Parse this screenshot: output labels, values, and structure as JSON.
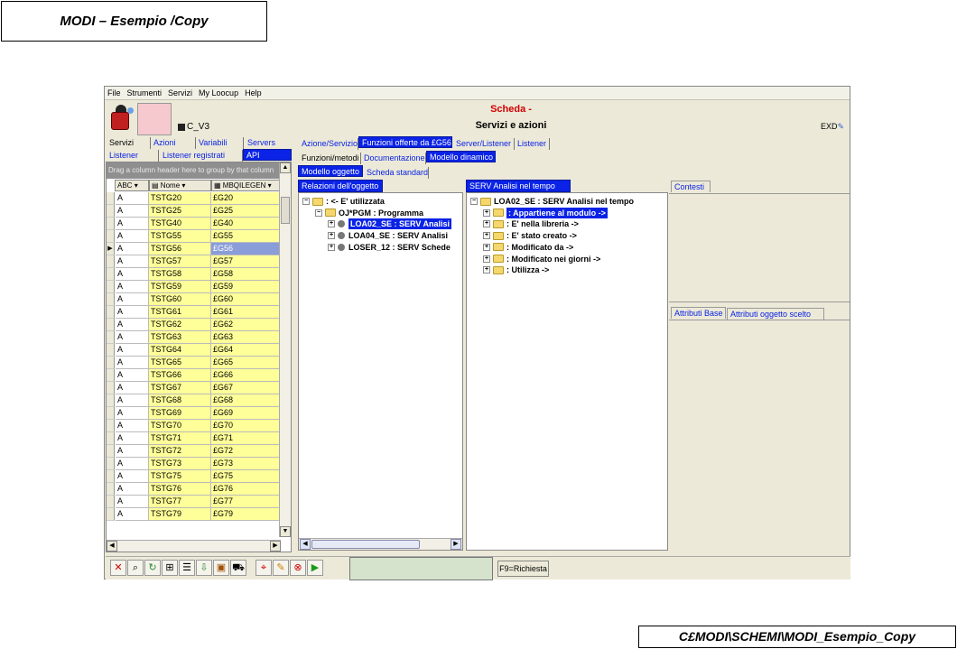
{
  "slide": {
    "title": "MODI – Esempio /Copy",
    "footer": "C£MODI\\SCHEMI\\MODI_Esempio_Copy"
  },
  "menu": [
    "File",
    "Strumenti",
    "Servizi",
    "My Loocup",
    "Help"
  ],
  "header": {
    "object_code": "C_V3",
    "title_red": "Scheda -",
    "title": "Servizi e azioni",
    "exd": "EXD"
  },
  "left_tabs_row1": [
    "Servizi",
    "Azioni",
    "Variabili",
    "Servers"
  ],
  "left_tabs_row2": [
    "Listener",
    "Listener registrati",
    "API"
  ],
  "right_tabs_row1": [
    "Azione/Servizio",
    "Funzioni offerte da £G56",
    "Server/Listener",
    "Listener"
  ],
  "right_tabs_row2": [
    "Funzioni/metodi",
    "Documentazione",
    "Modello dinamico"
  ],
  "right_tabs_row3": [
    "Modello oggetto",
    "Scheda standard"
  ],
  "grid": {
    "group_hint": "Drag a column header here to group by that column",
    "columns": [
      "ABC",
      "Nome",
      "MBQILEGEN"
    ],
    "rows": [
      [
        "A",
        "TSTG20",
        "£G20"
      ],
      [
        "A",
        "TSTG25",
        "£G25"
      ],
      [
        "A",
        "TSTG40",
        "£G40"
      ],
      [
        "A",
        "TSTG55",
        "£G55"
      ],
      [
        "A",
        "TSTG56",
        "£G56"
      ],
      [
        "A",
        "TSTG57",
        "£G57"
      ],
      [
        "A",
        "TSTG58",
        "£G58"
      ],
      [
        "A",
        "TSTG59",
        "£G59"
      ],
      [
        "A",
        "TSTG60",
        "£G60"
      ],
      [
        "A",
        "TSTG61",
        "£G61"
      ],
      [
        "A",
        "TSTG62",
        "£G62"
      ],
      [
        "A",
        "TSTG63",
        "£G63"
      ],
      [
        "A",
        "TSTG64",
        "£G64"
      ],
      [
        "A",
        "TSTG65",
        "£G65"
      ],
      [
        "A",
        "TSTG66",
        "£G66"
      ],
      [
        "A",
        "TSTG67",
        "£G67"
      ],
      [
        "A",
        "TSTG68",
        "£G68"
      ],
      [
        "A",
        "TSTG69",
        "£G69"
      ],
      [
        "A",
        "TSTG70",
        "£G70"
      ],
      [
        "A",
        "TSTG71",
        "£G71"
      ],
      [
        "A",
        "TSTG72",
        "£G72"
      ],
      [
        "A",
        "TSTG73",
        "£G73"
      ],
      [
        "A",
        "TSTG75",
        "£G75"
      ],
      [
        "A",
        "TSTG76",
        "£G76"
      ],
      [
        "A",
        "TSTG77",
        "£G77"
      ],
      [
        "A",
        "TSTG79",
        "£G79"
      ]
    ],
    "selected_index": 4
  },
  "rel_panel": {
    "title": "Relazioni dell'oggetto",
    "items": [
      {
        "text": ": <- E' utilizzata",
        "pm": "−",
        "kind": "folder"
      },
      {
        "text": "OJ*PGM  : Programma",
        "pm": "−",
        "kind": "folder"
      },
      {
        "text": "LOA02_SE  : SERV Analisi",
        "pm": "+",
        "kind": "bullet",
        "highlight": true
      },
      {
        "text": "LOA04_SE  : SERV Analisi",
        "pm": "+",
        "kind": "bullet"
      },
      {
        "text": "LOSER_12  : SERV Schede",
        "pm": "+",
        "kind": "bullet"
      }
    ]
  },
  "serv_panel": {
    "title": "SERV Analisi nel tempo",
    "items": [
      {
        "text": "LOA02_SE  : SERV Analisi nel tempo",
        "pm": "−",
        "kind": "folder"
      },
      {
        "text": ": Appartiene al modulo ->",
        "pm": "+",
        "kind": "folder",
        "highlight": true
      },
      {
        "text": ": E' nella libreria ->",
        "pm": "+",
        "kind": "folder"
      },
      {
        "text": ": E' stato creato ->",
        "pm": "+",
        "kind": "folder"
      },
      {
        "text": ": Modificato da ->",
        "pm": "+",
        "kind": "folder"
      },
      {
        "text": ": Modificato nei giorni ->",
        "pm": "+",
        "kind": "folder"
      },
      {
        "text": ": Utilizza ->",
        "pm": "+",
        "kind": "folder"
      }
    ]
  },
  "contesti_tab": "Contesti",
  "attr_tabs": [
    "Attributi Base",
    "Attributi oggetto scelto"
  ],
  "bottom": {
    "f9_label": "F9=Richiesta"
  }
}
